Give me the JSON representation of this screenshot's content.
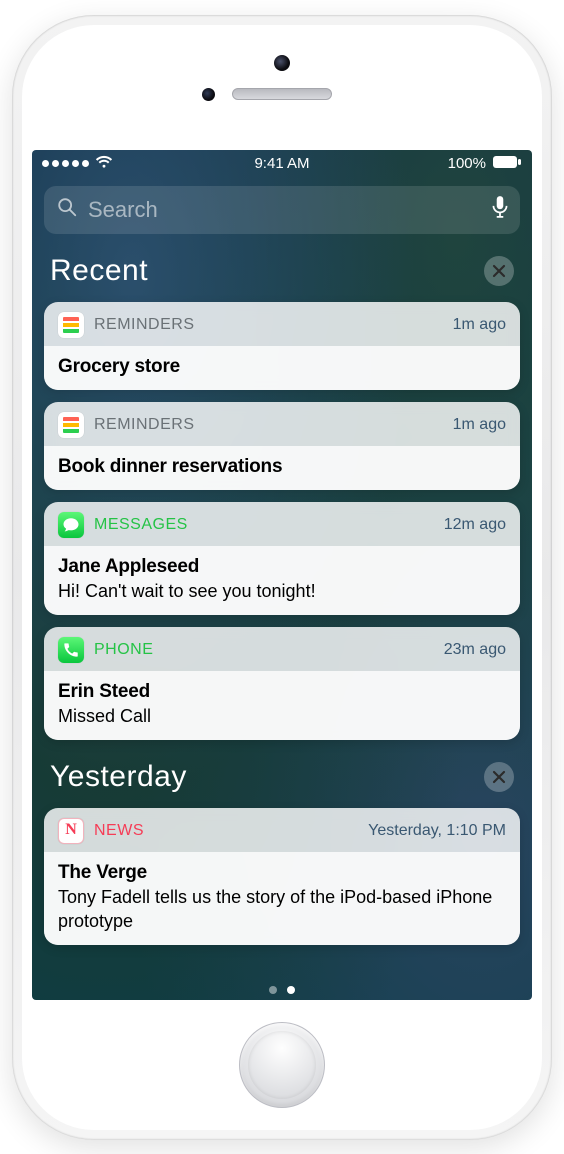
{
  "status": {
    "time": "9:41 AM",
    "battery_text": "100%"
  },
  "search": {
    "placeholder": "Search"
  },
  "sections": [
    {
      "title": "Recent",
      "cards": [
        {
          "app_key": "reminders",
          "app_label": "REMINDERS",
          "time": "1m ago",
          "title": "Grocery store",
          "body": ""
        },
        {
          "app_key": "reminders",
          "app_label": "REMINDERS",
          "time": "1m ago",
          "title": "Book dinner reservations",
          "body": ""
        },
        {
          "app_key": "messages",
          "app_label": "MESSAGES",
          "time": "12m ago",
          "title": "Jane Appleseed",
          "body": "Hi! Can't wait to see you tonight!"
        },
        {
          "app_key": "phone",
          "app_label": "PHONE",
          "time": "23m ago",
          "title": "Erin Steed",
          "body": "Missed Call"
        }
      ]
    },
    {
      "title": "Yesterday",
      "cards": [
        {
          "app_key": "news",
          "app_label": "NEWS",
          "time": "Yesterday, 1:10 PM",
          "title": "The Verge",
          "body": "Tony Fadell tells us the story of the iPod-based iPhone prototype"
        }
      ]
    }
  ],
  "pagination": {
    "count": 2,
    "active": 1
  }
}
